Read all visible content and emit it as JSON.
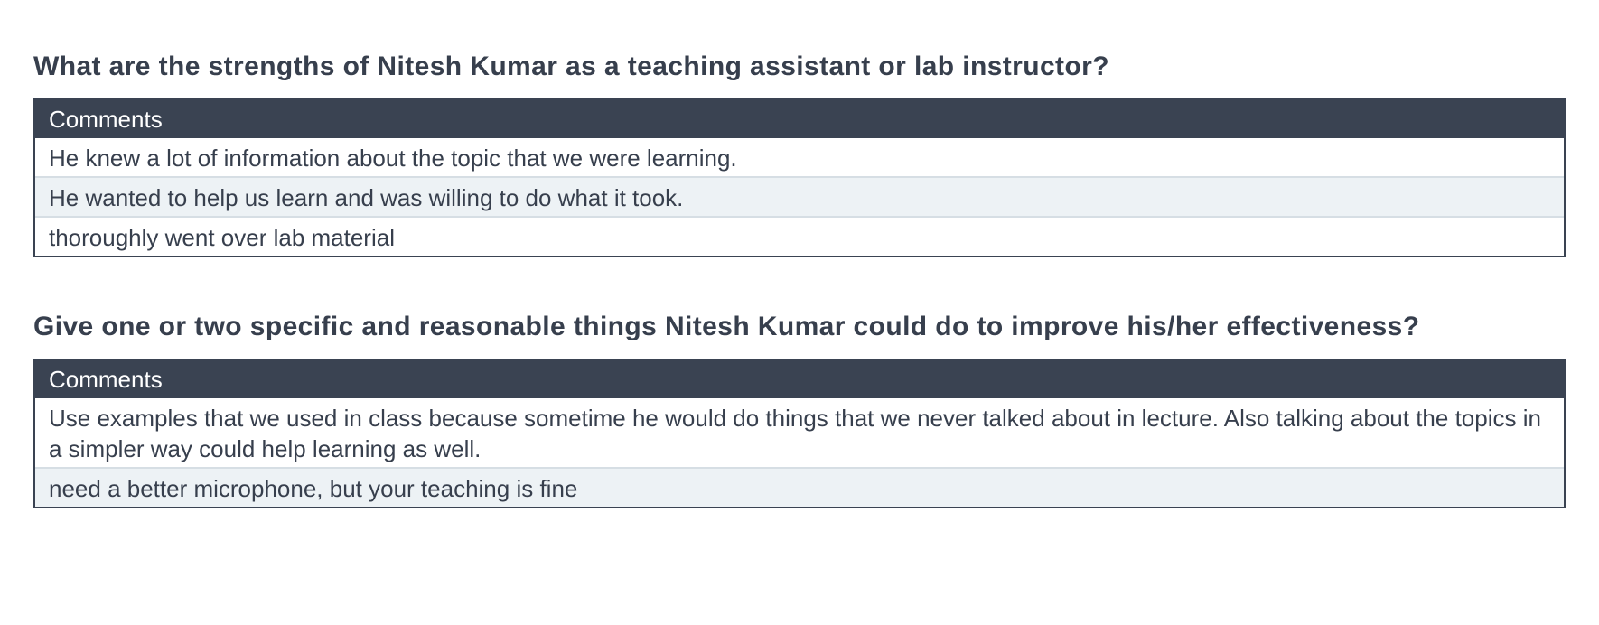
{
  "sections": [
    {
      "question": "What are the strengths of Nitesh Kumar as a teaching assistant or lab instructor?",
      "table_header": "Comments",
      "comments": [
        "He knew a lot of information about the topic that we were learning.",
        "He wanted to help us learn and was willing to do what it took.",
        "thoroughly went over lab material"
      ]
    },
    {
      "question": "Give one or two specific and reasonable things Nitesh Kumar could do to improve his/her effectiveness?",
      "table_header": "Comments",
      "comments": [
        "Use examples that we used in class because sometime he would do things that we never talked about in lecture. Also talking about the topics in a simpler way could help learning as well.",
        "need a better microphone, but your teaching is fine"
      ]
    }
  ],
  "colors": {
    "header_bg": "#3a4352",
    "alt_row_bg": "#edf2f5",
    "text": "#373f4d"
  }
}
